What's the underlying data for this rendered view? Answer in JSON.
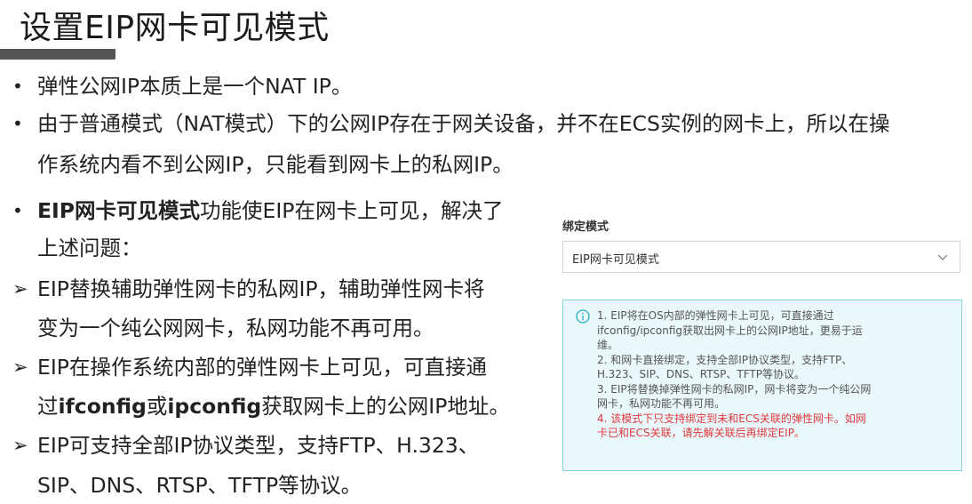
{
  "title": "设置EIP网卡可见模式",
  "bullets": {
    "b1": "弹性公网IP本质上是一个NAT IP。",
    "b2_line1": "由于普通模式（NAT模式）下的公网IP存在于网关设备，并不在ECS实例的网卡上，所以在操",
    "b2_line2": "作系统内看不到公网IP，只能看到网卡上的私网IP。",
    "b3_bold": "EIP网卡可见模式",
    "b3_line1_rest": "功能使EIP在网卡上可见，解决了",
    "b3_line2": "上述问题："
  },
  "arrows": {
    "a1_line1": "EIP替换辅助弹性网卡的私网IP，辅助弹性网卡将",
    "a1_line2": "变为一个纯公网网卡，私网功能不再可用。",
    "a2_line1": "EIP在操作系统内部的弹性网卡上可见，可直接通",
    "a2_line2_pre": "过",
    "a2_line2_b1": "ifconfig",
    "a2_line2_mid": "或",
    "a2_line2_b2": "ipconfig",
    "a2_line2_post": "获取网卡上的公网IP地址。",
    "a3_line1": "EIP可支持全部IP协议类型，支持FTP、H.323、",
    "a3_line2": "SIP、DNS、RTSP、TFTP等协议。"
  },
  "panel": {
    "field_label": "绑定模式",
    "select_value": "EIP网卡可见模式",
    "notice_lines": [
      "1. EIP将在OS内部的弹性网卡上可见，可直接通过",
      "ifconfig/ipconfig获取出网卡上的公网IP地址，更易于运",
      "维。",
      "2. 和网卡直接绑定，支持全部IP协议类型，支持FTP、",
      "H.323、SIP、DNS、RTSP、TFTP等协议。",
      "3. EIP将替换掉弹性网卡的私网IP，网卡将变为一个纯公网",
      "网卡，私网功能不再可用。"
    ],
    "warning_lines": [
      "4. 该模式下只支持绑定到未和ECS关联的弹性网卡。如网",
      "卡已和ECS关联，请先解关联后再绑定EIP。"
    ]
  },
  "colors": {
    "notice_border": "#7fd4de",
    "notice_bg": "#e9f8fb",
    "warning_text": "#e0393e",
    "title_bar": "#555555"
  },
  "icons": [
    "chevron-down-icon",
    "info-icon"
  ]
}
